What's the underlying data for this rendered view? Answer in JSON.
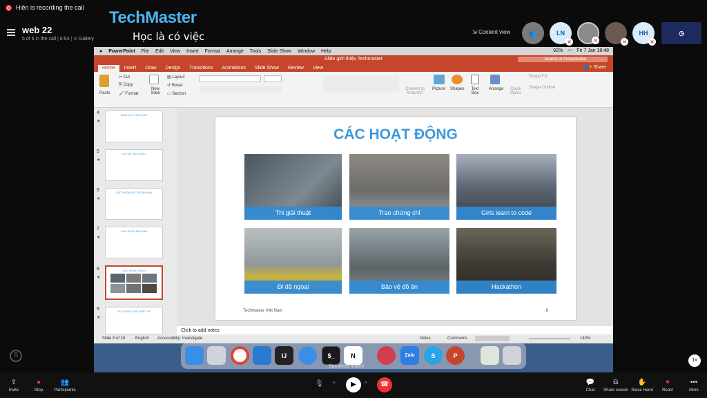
{
  "recording": {
    "text": "Hiên is recording the call"
  },
  "branding": {
    "logo": "TechMaster",
    "slogan": "Học là có việc"
  },
  "call": {
    "name": "web 22",
    "info": "5 of 6 in the call | 0:54 | ⊙ Gallery",
    "content_view": "Content view"
  },
  "participants": [
    {
      "initials": "",
      "color": "#7a7a7a"
    },
    {
      "initials": "LN",
      "color": "#d9ecfa"
    },
    {
      "initials": "",
      "color": "#8a8a8a"
    },
    {
      "initials": "",
      "color": "#6a5a50"
    },
    {
      "initials": "HH",
      "color": "#d9ecfa"
    },
    {
      "initials": "",
      "color": "#1c2a5e"
    }
  ],
  "macbar": {
    "app": "PowerPoint",
    "menus": [
      "File",
      "Edit",
      "View",
      "Insert",
      "Format",
      "Arrange",
      "Tools",
      "Slide Show",
      "Window",
      "Help"
    ],
    "battery": "92%",
    "datetime": "Fri 7 Jan 18:48"
  },
  "ppt": {
    "title": "Slide giới thiệu Techmaster",
    "search_placeholder": "Search in Presentation",
    "share": "Share",
    "tabs": [
      "Home",
      "Insert",
      "Draw",
      "Design",
      "Transitions",
      "Animations",
      "Slide Show",
      "Review",
      "View"
    ],
    "ribbon": {
      "paste": "Paste",
      "cut": "Cut",
      "copy": "Copy",
      "format": "Format",
      "new_slide": "New Slide",
      "layout": "Layout",
      "reset": "Reset",
      "section": "Section",
      "convert": "Convert to SmartArt",
      "picture": "Picture",
      "shapes": "Shapes",
      "textbox": "Text Box",
      "arrange": "Arrange",
      "quick_styles": "Quick Styles",
      "shape_fill": "Shape Fill",
      "shape_outline": "Shape Outline"
    },
    "thumbnails": [
      {
        "num": "4",
        "title": "DỊCH VỤ KHÓA HỌC"
      },
      {
        "num": "5",
        "title": "CƠ SỞ VẬT CHẤT"
      },
      {
        "num": "6",
        "title": "CÁC KHÓA HỌC NGẮN HẠN"
      },
      {
        "num": "7",
        "title": "CÁC KHÓA DÀI HẠN"
      },
      {
        "num": "8",
        "title": "CÁC HOẠT ĐỘNG"
      },
      {
        "num": "9",
        "title": "CÁC ĐƠN VỊ ĐÃ HỢP TÁC"
      }
    ],
    "slide": {
      "title": "CÁC HOẠT ĐỘNG",
      "photos": [
        {
          "caption": "Thi giải thuật",
          "color": "#5a6570"
        },
        {
          "caption": "Trao chứng chỉ",
          "color": "#7b7a78"
        },
        {
          "caption": "Girls learn to code",
          "color": "#6b7584"
        },
        {
          "caption": "Đi dã ngoại",
          "color": "#8a9396"
        },
        {
          "caption": "Bảo vệ đồ án",
          "color": "#6c7478"
        },
        {
          "caption": "Hackathon",
          "color": "#4e4a42"
        }
      ],
      "footer": "Techmaster Việt Nam",
      "page": "8"
    },
    "notes": "Click to add notes",
    "status": {
      "slide": "Slide 8 of 16",
      "lang": "English",
      "accessibility": "Accessibility: Investigate",
      "notes": "Notes",
      "comments": "Comments",
      "zoom": "140%"
    }
  },
  "dock": {
    "apps": [
      {
        "name": "Finder",
        "color": "#3b8ee8",
        "label": ""
      },
      {
        "name": "Launchpad",
        "color": "#e0e0e0",
        "label": ""
      },
      {
        "name": "Chrome",
        "color": "#ffffff",
        "label": ""
      },
      {
        "name": "VS Code",
        "color": "#2a7ad1",
        "label": ""
      },
      {
        "name": "IntelliJ",
        "color": "#222222",
        "label": "IJ"
      },
      {
        "name": "Xcode",
        "color": "#3e8ee8",
        "label": ""
      },
      {
        "name": "Terminal",
        "color": "#1a1a1a",
        "label": "$_"
      },
      {
        "name": "Notion",
        "color": "#ffffff",
        "label": "N"
      },
      {
        "name": "Speaker Deck",
        "color": "#d33e4f",
        "label": ""
      },
      {
        "name": "Zalo",
        "color": "#2e7ee3",
        "label": "Zalo"
      },
      {
        "name": "Skype",
        "color": "#2aa4e6",
        "label": "S"
      },
      {
        "name": "PowerPoint",
        "color": "#c5462a",
        "label": "P"
      },
      {
        "name": "Preview",
        "color": "#dfe5da",
        "label": ""
      },
      {
        "name": "Trash",
        "color": "#cfd3d6",
        "label": ""
      }
    ]
  },
  "speakers_muted": "Speakers muted",
  "speed_badge": "1x",
  "bottom": {
    "left": [
      "Invite",
      "Stop",
      "Participants"
    ],
    "right": [
      "Chat",
      "Share screen",
      "Raise Hand",
      "React",
      "More"
    ]
  }
}
